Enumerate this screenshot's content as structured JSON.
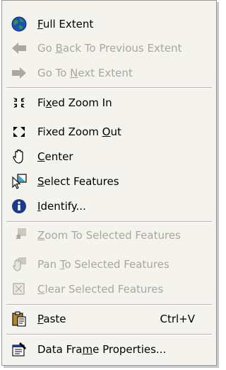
{
  "menu": {
    "items": [
      {
        "label_pre": "",
        "label_u": "F",
        "label_post": "ull Extent",
        "enabled": true
      },
      {
        "label_pre": "Go ",
        "label_u": "B",
        "label_post": "ack To Previous Extent",
        "enabled": false
      },
      {
        "label_pre": "Go To ",
        "label_u": "N",
        "label_post": "ext Extent",
        "enabled": false
      },
      {
        "label_pre": "Fi",
        "label_u": "x",
        "label_post": "ed Zoom In",
        "enabled": true
      },
      {
        "label_pre": "Fixed Zoom ",
        "label_u": "O",
        "label_post": "ut",
        "enabled": true
      },
      {
        "label_pre": "",
        "label_u": "C",
        "label_post": "enter",
        "enabled": true
      },
      {
        "label_pre": "",
        "label_u": "S",
        "label_post": "elect Features",
        "enabled": true
      },
      {
        "label_pre": "",
        "label_u": "I",
        "label_post": "dentify...",
        "enabled": true
      },
      {
        "label_pre": "",
        "label_u": "Z",
        "label_post": "oom To Selected Features",
        "enabled": false
      },
      {
        "label_pre": "Pan ",
        "label_u": "T",
        "label_post": "o Selected Features",
        "enabled": false
      },
      {
        "label_pre": "",
        "label_u": "C",
        "label_post": "lear Selected Features",
        "enabled": false
      },
      {
        "label_pre": "",
        "label_u": "P",
        "label_post": "aste",
        "enabled": true,
        "shortcut": "Ctrl+V"
      },
      {
        "label_pre": "Data Fra",
        "label_u": "m",
        "label_post": "e Properties...",
        "enabled": true
      }
    ]
  },
  "colors": {
    "menu_bg": "#f4f3ee",
    "disabled_text": "#a7a6a0",
    "globe_blue": "#1f4fb8",
    "globe_green": "#2e9a2e",
    "info_blue": "#1a3b8c"
  }
}
